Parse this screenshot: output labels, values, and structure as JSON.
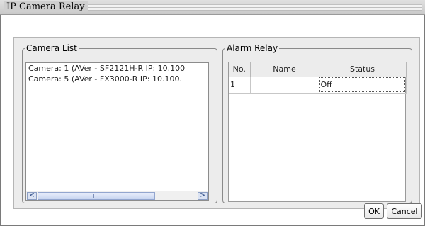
{
  "window": {
    "title": "IP Camera Relay"
  },
  "camera_list": {
    "legend": "Camera List",
    "items": [
      "Camera: 1 (AVer - SF2121H-R IP: 10.100",
      "Camera: 5 (AVer - FX3000-R IP: 10.100."
    ],
    "scrollbar": {
      "left_arrow": "<",
      "right_arrow": ">"
    }
  },
  "alarm_relay": {
    "legend": "Alarm Relay",
    "columns": [
      "No.",
      "Name",
      "Status"
    ],
    "rows": [
      {
        "no": "1",
        "name": "",
        "status": "Off"
      }
    ]
  },
  "buttons": {
    "ok": "OK",
    "cancel": "Cancel"
  }
}
